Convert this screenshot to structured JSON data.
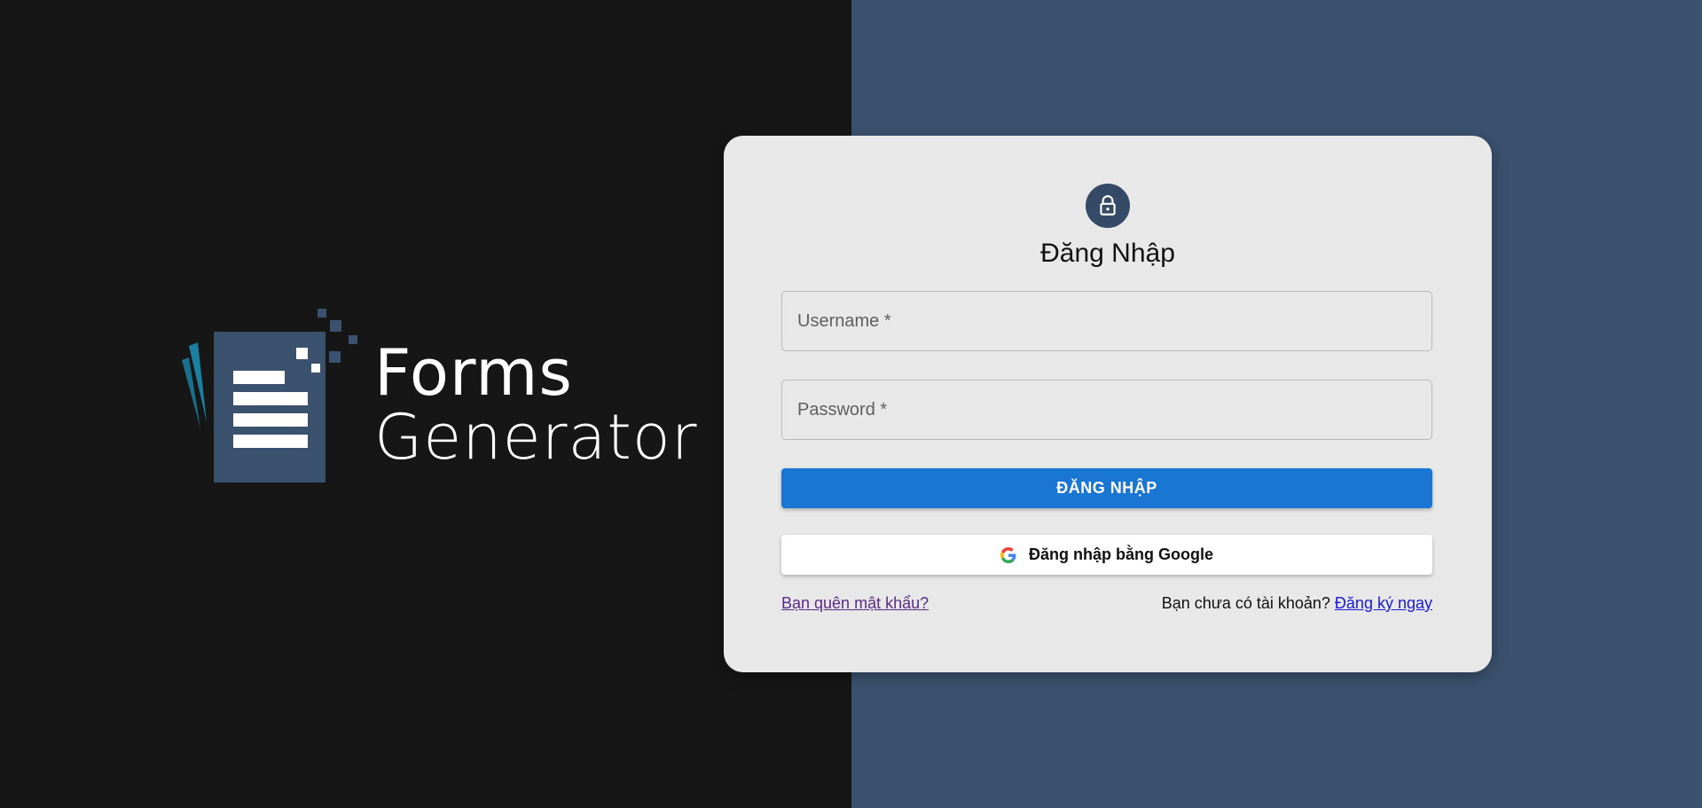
{
  "branding": {
    "line1": "Forms",
    "line2": "Generator",
    "logo_icon": "document-logo-icon"
  },
  "colors": {
    "left_bg": "#161616",
    "right_bg": "#3b526f",
    "card_bg": "#e8e8e8",
    "primary": "#1976d2",
    "avatar_bg": "#344a66",
    "logo_blue": "#3b526f",
    "logo_accent": "#1a7fa0"
  },
  "login": {
    "icon": "lock-icon",
    "title": "Đăng Nhập",
    "username_placeholder": "Username *",
    "password_placeholder": "Password *",
    "username_value": "",
    "password_value": "",
    "submit_label": "ĐĂNG NHẬP",
    "google_label": "Đăng nhập bằng Google",
    "google_icon": "google-icon",
    "forgot_label": "Bạn quên mật khẩu?",
    "signup_prompt": "Bạn chưa có tài khoản?",
    "signup_label": "Đăng ký ngay"
  }
}
